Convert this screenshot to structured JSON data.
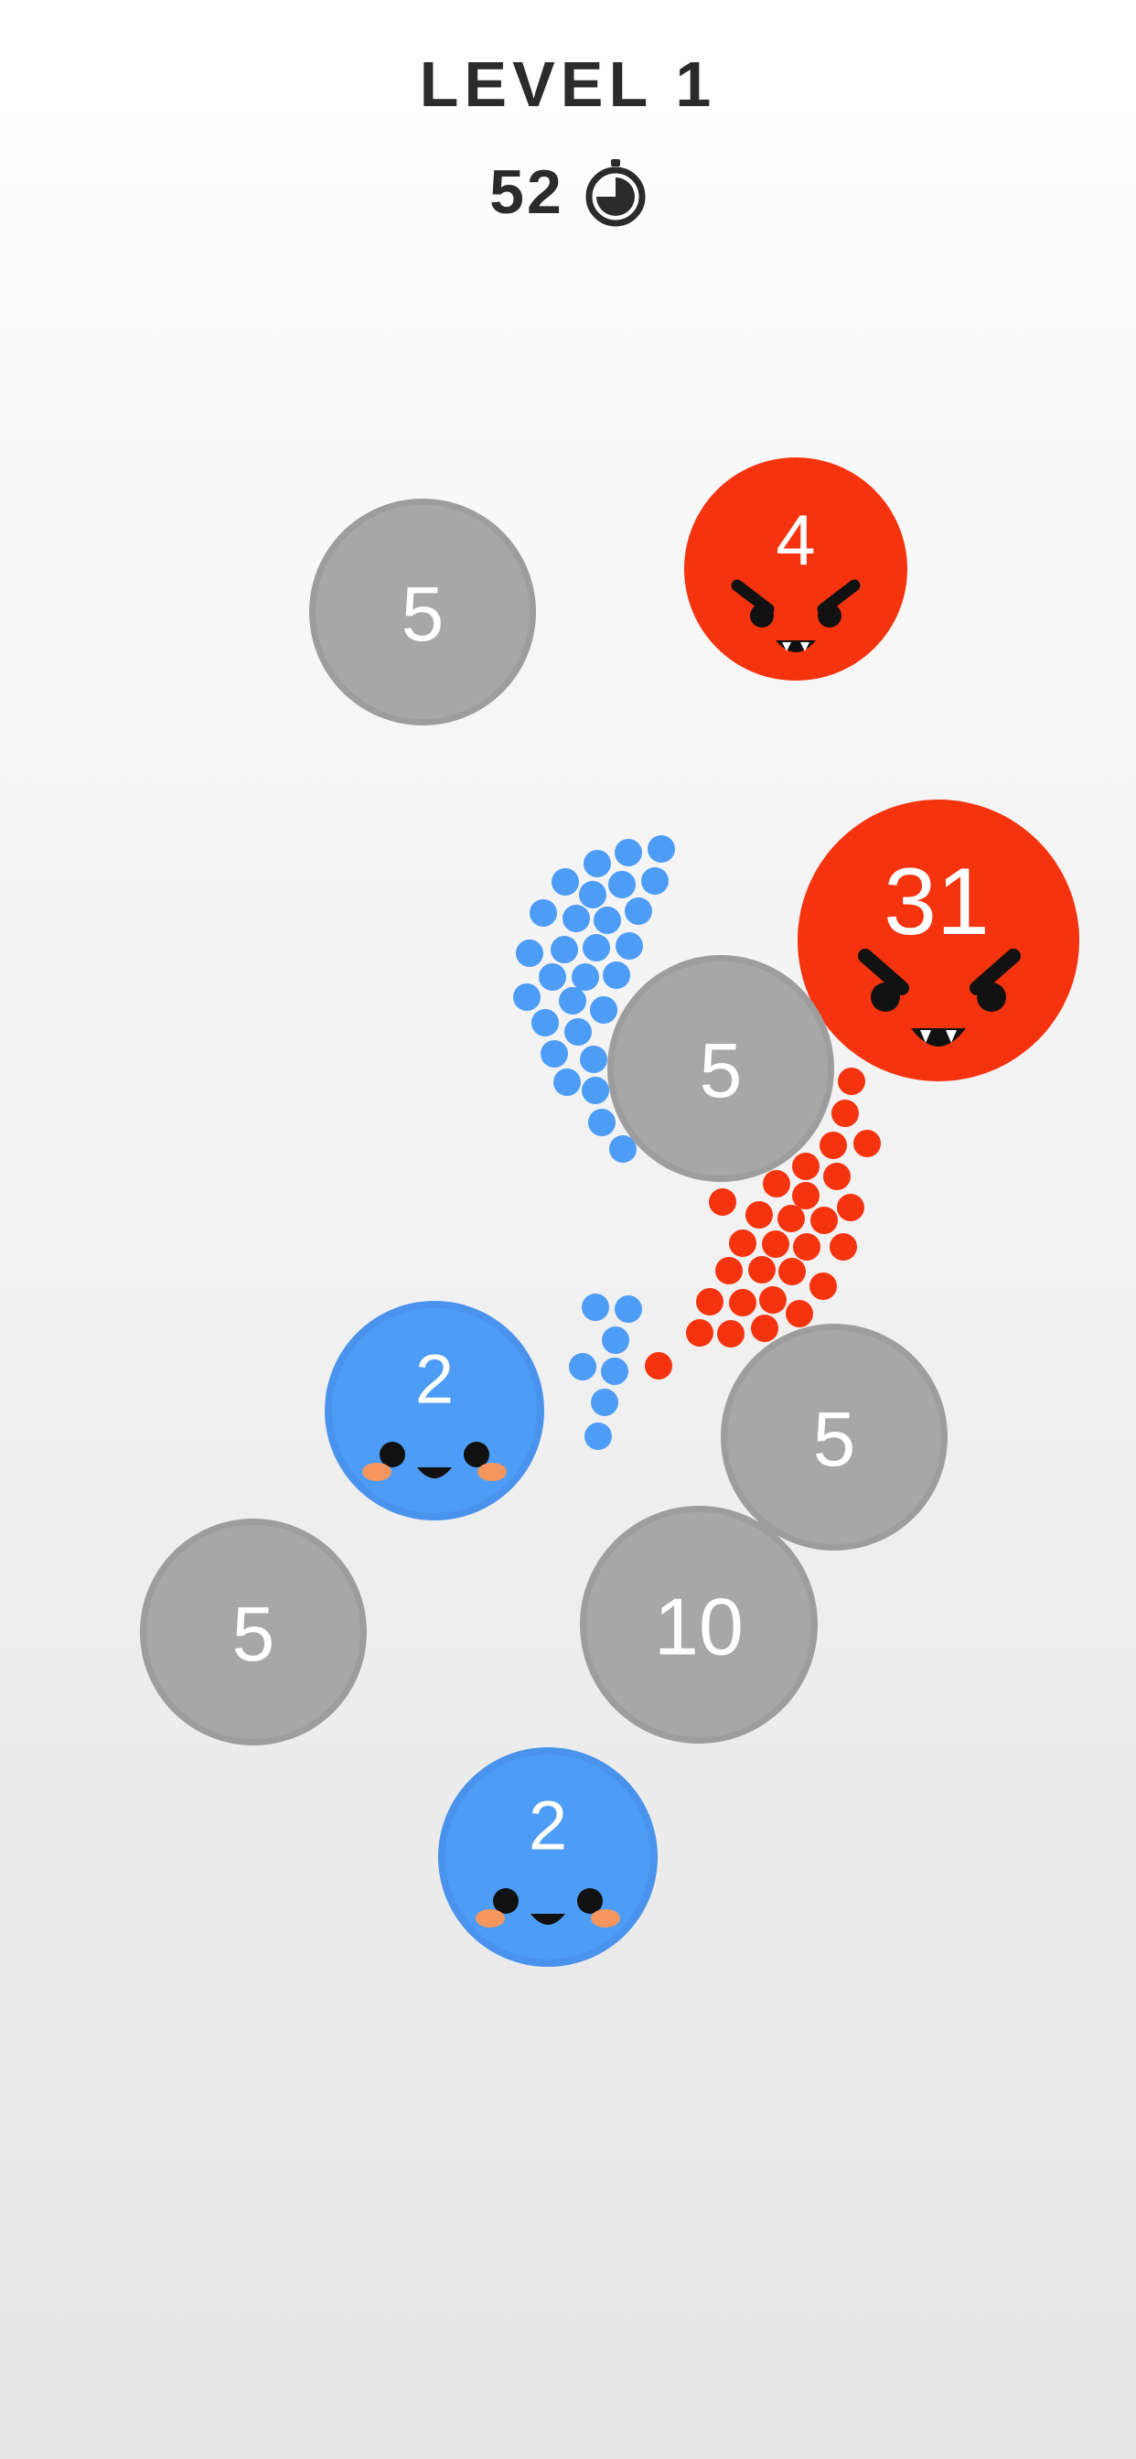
{
  "hud": {
    "level_label": "LEVEL 1",
    "timer_value": "52",
    "timer_icon": "stopwatch-icon"
  },
  "colors": {
    "player": "#4d9cf6",
    "enemy": "#f5340f",
    "neutral": "#a7a7a7",
    "neutral_ring": "#9d9d9d",
    "text": "#2b2b2b",
    "blush": "#f4965d"
  },
  "bases": [
    {
      "id": "neutral-base-1",
      "team": "neutral",
      "count": "5"
    },
    {
      "id": "enemy-base-1",
      "team": "enemy",
      "count": "4"
    },
    {
      "id": "enemy-base-2",
      "team": "enemy",
      "count": "31"
    },
    {
      "id": "neutral-base-2",
      "team": "neutral",
      "count": "5"
    },
    {
      "id": "player-base-1",
      "team": "player",
      "count": "2"
    },
    {
      "id": "neutral-base-3",
      "team": "neutral",
      "count": "5"
    },
    {
      "id": "neutral-base-4",
      "team": "neutral",
      "count": "5"
    },
    {
      "id": "neutral-base-5",
      "team": "neutral",
      "count": "10"
    },
    {
      "id": "player-base-2",
      "team": "player",
      "count": "2"
    }
  ]
}
